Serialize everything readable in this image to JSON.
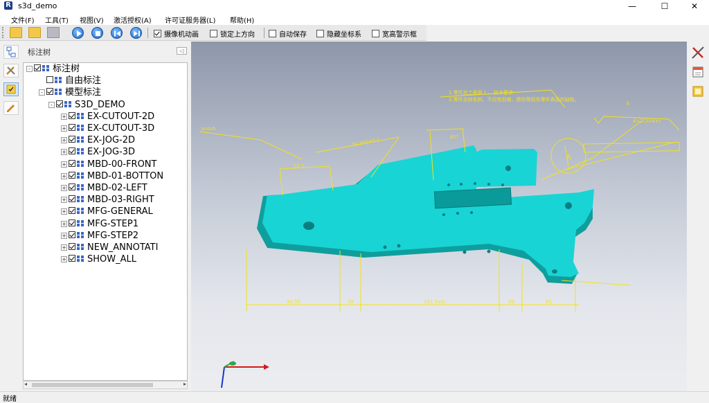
{
  "window": {
    "title": "s3d_demo",
    "icon_letter": "R",
    "minimize": "—",
    "maximize": "☐",
    "close": "✕"
  },
  "menu": [
    "文件(F)",
    "工具(T)",
    "视图(V)",
    "激活授权(A)",
    "许可证服务器(L)",
    "帮助(H)"
  ],
  "toolbar": {
    "buttons": [
      "open-file-icon",
      "open-folder-icon",
      "save-icon",
      "play-icon",
      "stop-icon",
      "skip-back-icon",
      "skip-forward-icon"
    ],
    "checks": [
      {
        "label": "摄像机动画",
        "checked": true
      },
      {
        "label": "锁定上方向",
        "checked": false
      },
      {
        "label": "自动保存",
        "checked": false
      },
      {
        "label": "隐藏坐标系",
        "checked": false
      },
      {
        "label": "宽高警示框",
        "checked": false
      }
    ]
  },
  "panel": {
    "title": "标注树",
    "collapse_glyph": "◁"
  },
  "tree": [
    {
      "label": "标注树",
      "level": 0,
      "expander": "-",
      "checked": true,
      "icon": true
    },
    {
      "label": "自由标注",
      "level": 1,
      "expander": "",
      "checked": false,
      "icon": true
    },
    {
      "label": "模型标注",
      "level": 1,
      "expander": "-",
      "checked": true,
      "icon": true
    },
    {
      "label": "S3D_DEMO",
      "level": 2,
      "expander": "-",
      "checked": true,
      "icon": true
    },
    {
      "label": "EX-CUTOUT-2D",
      "level": 3,
      "expander": "+",
      "checked": true,
      "icon": true
    },
    {
      "label": "EX-CUTOUT-3D",
      "level": 3,
      "expander": "+",
      "checked": true,
      "icon": true
    },
    {
      "label": "EX-JOG-2D",
      "level": 3,
      "expander": "+",
      "checked": true,
      "icon": true
    },
    {
      "label": "EX-JOG-3D",
      "level": 3,
      "expander": "+",
      "checked": true,
      "icon": true
    },
    {
      "label": "MBD-00-FRONT",
      "level": 3,
      "expander": "+",
      "checked": true,
      "icon": true
    },
    {
      "label": "MBD-01-BOTTON",
      "level": 3,
      "expander": "+",
      "checked": true,
      "icon": true
    },
    {
      "label": "MBD-02-LEFT",
      "level": 3,
      "expander": "+",
      "checked": true,
      "icon": true
    },
    {
      "label": "MBD-03-RIGHT",
      "level": 3,
      "expander": "+",
      "checked": true,
      "icon": true
    },
    {
      "label": "MFG-GENERAL",
      "level": 3,
      "expander": "+",
      "checked": true,
      "icon": true
    },
    {
      "label": "MFG-STEP1",
      "level": 3,
      "expander": "+",
      "checked": true,
      "icon": true
    },
    {
      "label": "MFG-STEP2",
      "level": 3,
      "expander": "+",
      "checked": true,
      "icon": true
    },
    {
      "label": "NEW_ANNOTATI",
      "level": 3,
      "expander": "+",
      "checked": true,
      "icon": true
    },
    {
      "label": "SHOW_ALL",
      "level": 3,
      "expander": "+",
      "checked": true,
      "icon": true
    }
  ],
  "viewport": {
    "model_color": "#19d4d4",
    "annotation_color": "#f2e21a",
    "labels": {
      "note1": "1.零件加工表面上，  技术要求",
      "note2": "2.零件去除毛刺、不应有划痕、擦伤等损伤零件表面的缺陷。",
      "dim_angle": "60°",
      "dim_long": "79.383±0.1",
      "dim_small": "51.5",
      "side_label": "andvb",
      "dim_bottom1": "92.55",
      "dim_bottom2": "58",
      "dim_bottom3": "181.5±0",
      "dim_bottom4": "50",
      "dim_bottom5": "85",
      "tol_num": "3",
      "tol_frame": "4×2(3)(4×)",
      "datum": "A"
    }
  },
  "status": "就绪"
}
